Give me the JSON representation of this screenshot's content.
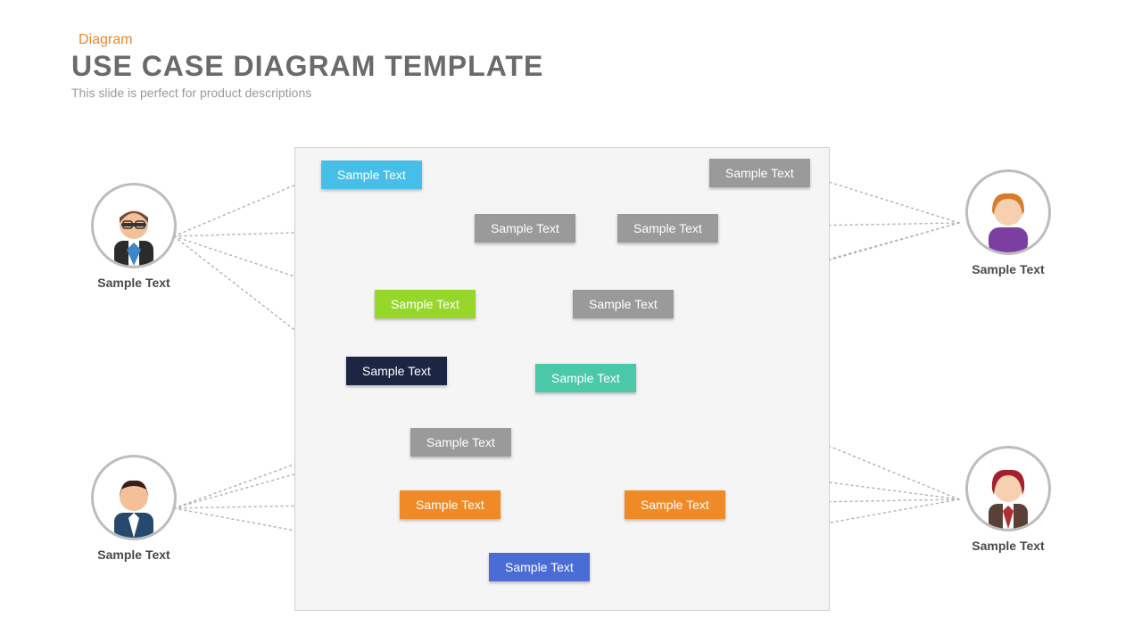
{
  "header": {
    "eyebrow": "Diagram",
    "title": "USE CASE DIAGRAM TEMPLATE",
    "subtitle": "This slide is perfect for product descriptions"
  },
  "actors": {
    "top_left": {
      "label": "Sample Text"
    },
    "bottom_left": {
      "label": "Sample Text"
    },
    "top_right": {
      "label": "Sample Text"
    },
    "bottom_right": {
      "label": "Sample Text"
    }
  },
  "usecases": {
    "uc1": {
      "label": "Sample Text",
      "color": "#46bfe8"
    },
    "uc2": {
      "label": "Sample Text",
      "color": "#9a9a9a"
    },
    "uc3": {
      "label": "Sample Text",
      "color": "#9a9a9a"
    },
    "uc4": {
      "label": "Sample Text",
      "color": "#9a9a9a"
    },
    "uc5": {
      "label": "Sample Text",
      "color": "#97d72a"
    },
    "uc6": {
      "label": "Sample Text",
      "color": "#9a9a9a"
    },
    "uc7": {
      "label": "Sample Text",
      "color": "#1c2541"
    },
    "uc8": {
      "label": "Sample Text",
      "color": "#4ac8a8"
    },
    "uc9": {
      "label": "Sample Text",
      "color": "#9a9a9a"
    },
    "uc10": {
      "label": "Sample Text",
      "color": "#ef8a26"
    },
    "uc11": {
      "label": "Sample Text",
      "color": "#ef8a26"
    },
    "uc12": {
      "label": "Sample Text",
      "color": "#4a6cd4"
    }
  },
  "connections": [
    {
      "from": "actor_tl",
      "to": "uc1"
    },
    {
      "from": "actor_tl",
      "to": "uc3"
    },
    {
      "from": "actor_tl",
      "to": "uc5"
    },
    {
      "from": "actor_tl",
      "to": "uc7"
    },
    {
      "from": "actor_bl",
      "to": "uc9"
    },
    {
      "from": "actor_bl",
      "to": "uc10"
    },
    {
      "from": "actor_bl",
      "to": "uc12"
    },
    {
      "from": "actor_bl",
      "to": "uc8"
    },
    {
      "from": "actor_tr",
      "to": "uc2"
    },
    {
      "from": "actor_tr",
      "to": "uc4"
    },
    {
      "from": "actor_tr",
      "to": "uc6"
    },
    {
      "from": "actor_tr",
      "to": "uc7"
    },
    {
      "from": "actor_br",
      "to": "uc8"
    },
    {
      "from": "actor_br",
      "to": "uc9"
    },
    {
      "from": "actor_br",
      "to": "uc11"
    },
    {
      "from": "actor_br",
      "to": "uc12"
    }
  ]
}
